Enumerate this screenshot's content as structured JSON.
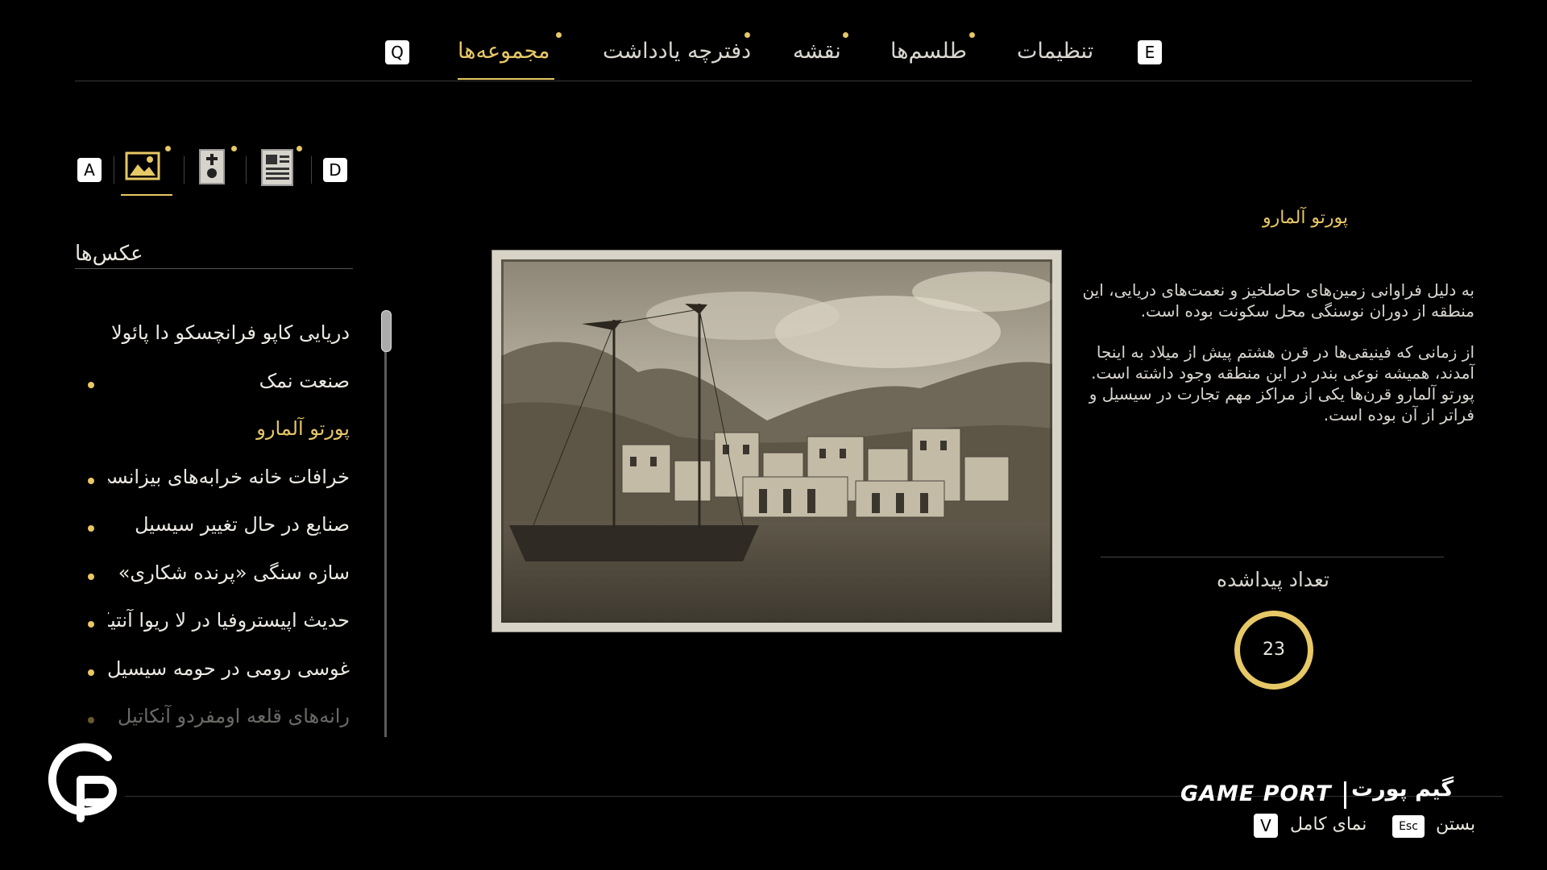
{
  "top_nav": {
    "key_left": "Q",
    "key_right": "E",
    "tabs": [
      {
        "label": "مجموعه‌ها",
        "active": true
      },
      {
        "label": "دفترچه یادداشت",
        "active": false
      },
      {
        "label": "نقشه",
        "active": false
      },
      {
        "label": "طلسم‌ها",
        "active": false
      },
      {
        "label": "تنظیمات",
        "active": false
      }
    ]
  },
  "category_bar": {
    "key_left": "A",
    "key_right": "D",
    "icons": [
      "photo-icon",
      "reliquary-icon",
      "document-icon"
    ],
    "active": "photo-icon"
  },
  "sidebar": {
    "title": "عکس‌ها",
    "items": [
      {
        "label": "دریایی کاپو فرانچسکو دا پائولا",
        "bullet": false,
        "active": false
      },
      {
        "label": "صنعت نمک",
        "bullet": true,
        "active": false
      },
      {
        "label": "پورتو آلمارو",
        "bullet": false,
        "active": true
      },
      {
        "label": "خرافات خانه خرابه‌های بیزانسی",
        "bullet": true,
        "active": false
      },
      {
        "label": "صنایع در حال تغییر سیسیل",
        "bullet": true,
        "active": false
      },
      {
        "label": "سازه سنگی «پرنده شکاری»",
        "bullet": true,
        "active": false
      },
      {
        "label": "حدیث اپیستروفیا در لا ریوا آنتیکا",
        "bullet": true,
        "active": false
      },
      {
        "label": "غوسی رومی در حومه سیسیل",
        "bullet": true,
        "active": false
      },
      {
        "label": "رانه‌های قلعه اومفردو آنکاتیل",
        "bullet": true,
        "active": false,
        "faded": true
      }
    ]
  },
  "detail": {
    "title": "پورتو آلمارو",
    "paragraph_1": "به دلیل فراوانی زمین‌های حاصلخیز و نعمت‌های دریایی، این منطقه از دوران نوسنگی محل سکونت بوده است.",
    "paragraph_2": "از زمانی که فینیقی‌ها در قرن هشتم پیش از میلاد به اینجا آمدند، همیشه نوعی بندر در این منطقه وجود داشته است. پورتو آلمارو قرن‌ها یکی از مراکز مهم تجارت در سیسیل و فراتر از آن بوده است.",
    "found_label": "تعداد پیداشده",
    "found_count": "23"
  },
  "footer": {
    "close_label": "بستن",
    "close_key": "Esc",
    "fullview_label": "نمای کامل",
    "fullview_key": "V",
    "brand_en": "GAME PORT",
    "brand_fa": "گیم پورت"
  },
  "colors": {
    "accent": "#e7c866",
    "background": "#000000",
    "text": "#e9e6dd"
  }
}
